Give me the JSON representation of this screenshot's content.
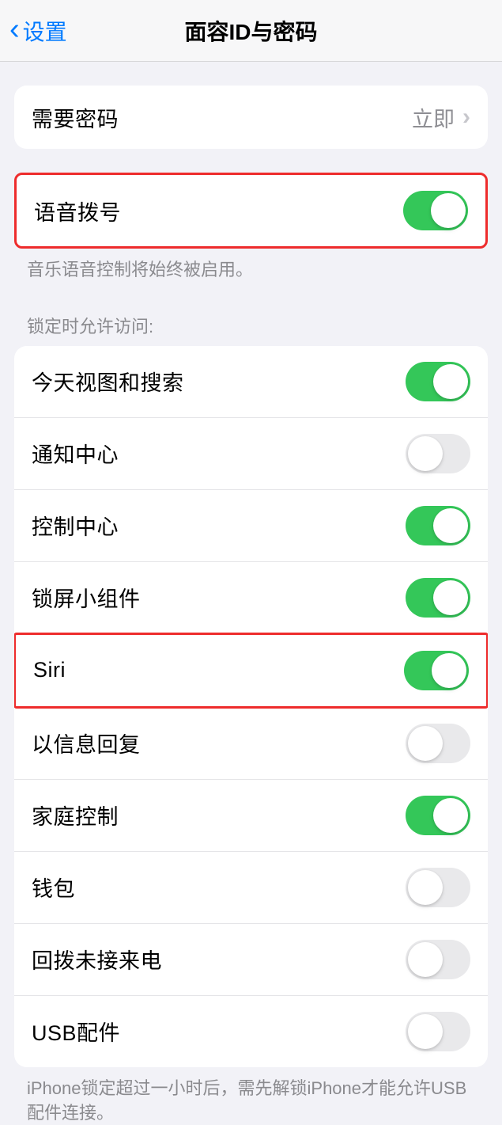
{
  "header": {
    "back_label": "设置",
    "title": "面容ID与密码"
  },
  "passcode_row": {
    "label": "需要密码",
    "value": "立即"
  },
  "voice_dial": {
    "label": "语音拨号",
    "on": true,
    "footer": "音乐语音控制将始终被启用。"
  },
  "lock_access": {
    "header": "锁定时允许访问:",
    "items": [
      {
        "label": "今天视图和搜索",
        "on": true
      },
      {
        "label": "通知中心",
        "on": false
      },
      {
        "label": "控制中心",
        "on": true
      },
      {
        "label": "锁屏小组件",
        "on": true
      },
      {
        "label": "Siri",
        "on": true,
        "highlighted": true
      },
      {
        "label": "以信息回复",
        "on": false
      },
      {
        "label": "家庭控制",
        "on": true
      },
      {
        "label": "钱包",
        "on": false
      },
      {
        "label": "回拨未接来电",
        "on": false
      },
      {
        "label": "USB配件",
        "on": false
      }
    ],
    "footer": "iPhone锁定超过一小时后，需先解锁iPhone才能允许USB配件连接。"
  }
}
